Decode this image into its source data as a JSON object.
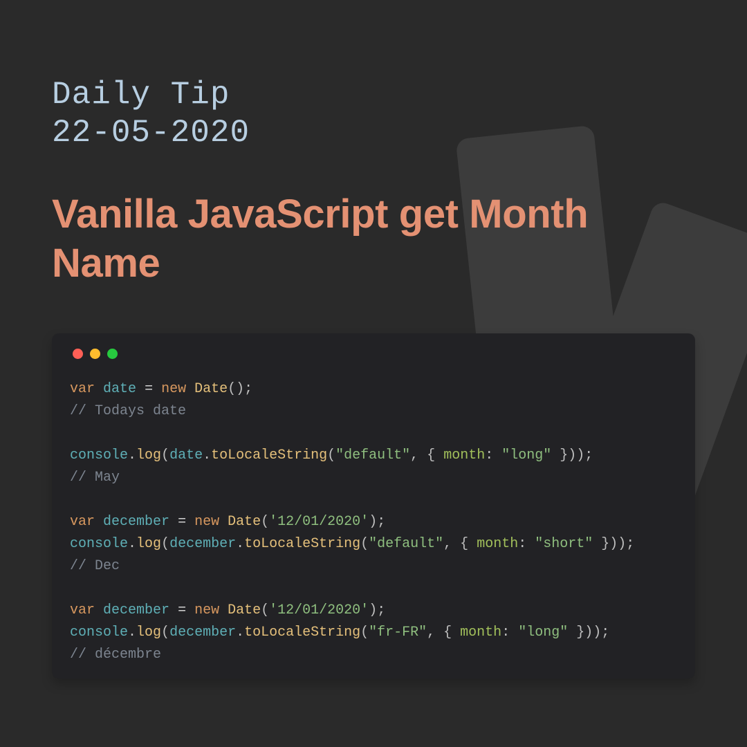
{
  "header": {
    "kicker_line1": "Daily Tip",
    "kicker_line2": "22-05-2020",
    "title": "Vanilla JavaScript get Month Name"
  },
  "colors": {
    "background": "#2a2a2a",
    "kicker": "#b7cee1",
    "title": "#e49173",
    "code_bg": "#222225"
  },
  "window_dots": [
    "red",
    "yellow",
    "green"
  ],
  "code": {
    "tokens": [
      {
        "t": "keyword",
        "v": "var"
      },
      {
        "t": "text",
        "v": " "
      },
      {
        "t": "var",
        "v": "date"
      },
      {
        "t": "text",
        "v": " "
      },
      {
        "t": "operator",
        "v": "="
      },
      {
        "t": "text",
        "v": " "
      },
      {
        "t": "keyword",
        "v": "new"
      },
      {
        "t": "text",
        "v": " "
      },
      {
        "t": "class",
        "v": "Date"
      },
      {
        "t": "punct",
        "v": "();"
      },
      {
        "t": "nl"
      },
      {
        "t": "comment",
        "v": "// Todays date"
      },
      {
        "t": "nl"
      },
      {
        "t": "nl"
      },
      {
        "t": "var",
        "v": "console"
      },
      {
        "t": "punct",
        "v": "."
      },
      {
        "t": "method",
        "v": "log"
      },
      {
        "t": "punct",
        "v": "("
      },
      {
        "t": "var",
        "v": "date"
      },
      {
        "t": "punct",
        "v": "."
      },
      {
        "t": "method",
        "v": "toLocaleString"
      },
      {
        "t": "punct",
        "v": "("
      },
      {
        "t": "string",
        "v": "\"default\""
      },
      {
        "t": "punct",
        "v": ", { "
      },
      {
        "t": "prop",
        "v": "month"
      },
      {
        "t": "punct",
        "v": ": "
      },
      {
        "t": "string",
        "v": "\"long\""
      },
      {
        "t": "punct",
        "v": " }));"
      },
      {
        "t": "nl"
      },
      {
        "t": "comment",
        "v": "// May"
      },
      {
        "t": "nl"
      },
      {
        "t": "nl"
      },
      {
        "t": "keyword",
        "v": "var"
      },
      {
        "t": "text",
        "v": " "
      },
      {
        "t": "var",
        "v": "december"
      },
      {
        "t": "text",
        "v": " "
      },
      {
        "t": "operator",
        "v": "="
      },
      {
        "t": "text",
        "v": " "
      },
      {
        "t": "keyword",
        "v": "new"
      },
      {
        "t": "text",
        "v": " "
      },
      {
        "t": "class",
        "v": "Date"
      },
      {
        "t": "punct",
        "v": "("
      },
      {
        "t": "string",
        "v": "'12/01/2020'"
      },
      {
        "t": "punct",
        "v": ");"
      },
      {
        "t": "nl"
      },
      {
        "t": "var",
        "v": "console"
      },
      {
        "t": "punct",
        "v": "."
      },
      {
        "t": "method",
        "v": "log"
      },
      {
        "t": "punct",
        "v": "("
      },
      {
        "t": "var",
        "v": "december"
      },
      {
        "t": "punct",
        "v": "."
      },
      {
        "t": "method",
        "v": "toLocaleString"
      },
      {
        "t": "punct",
        "v": "("
      },
      {
        "t": "string",
        "v": "\"default\""
      },
      {
        "t": "punct",
        "v": ", { "
      },
      {
        "t": "prop",
        "v": "month"
      },
      {
        "t": "punct",
        "v": ": "
      },
      {
        "t": "string",
        "v": "\"short\""
      },
      {
        "t": "punct",
        "v": " }));"
      },
      {
        "t": "nl"
      },
      {
        "t": "comment",
        "v": "// Dec"
      },
      {
        "t": "nl"
      },
      {
        "t": "nl"
      },
      {
        "t": "keyword",
        "v": "var"
      },
      {
        "t": "text",
        "v": " "
      },
      {
        "t": "var",
        "v": "december"
      },
      {
        "t": "text",
        "v": " "
      },
      {
        "t": "operator",
        "v": "="
      },
      {
        "t": "text",
        "v": " "
      },
      {
        "t": "keyword",
        "v": "new"
      },
      {
        "t": "text",
        "v": " "
      },
      {
        "t": "class",
        "v": "Date"
      },
      {
        "t": "punct",
        "v": "("
      },
      {
        "t": "string",
        "v": "'12/01/2020'"
      },
      {
        "t": "punct",
        "v": ");"
      },
      {
        "t": "nl"
      },
      {
        "t": "var",
        "v": "console"
      },
      {
        "t": "punct",
        "v": "."
      },
      {
        "t": "method",
        "v": "log"
      },
      {
        "t": "punct",
        "v": "("
      },
      {
        "t": "var",
        "v": "december"
      },
      {
        "t": "punct",
        "v": "."
      },
      {
        "t": "method",
        "v": "toLocaleString"
      },
      {
        "t": "punct",
        "v": "("
      },
      {
        "t": "string",
        "v": "\"fr-FR\""
      },
      {
        "t": "punct",
        "v": ", { "
      },
      {
        "t": "prop",
        "v": "month"
      },
      {
        "t": "punct",
        "v": ": "
      },
      {
        "t": "string",
        "v": "\"long\""
      },
      {
        "t": "punct",
        "v": " }));"
      },
      {
        "t": "nl"
      },
      {
        "t": "comment",
        "v": "// décembre"
      }
    ]
  }
}
